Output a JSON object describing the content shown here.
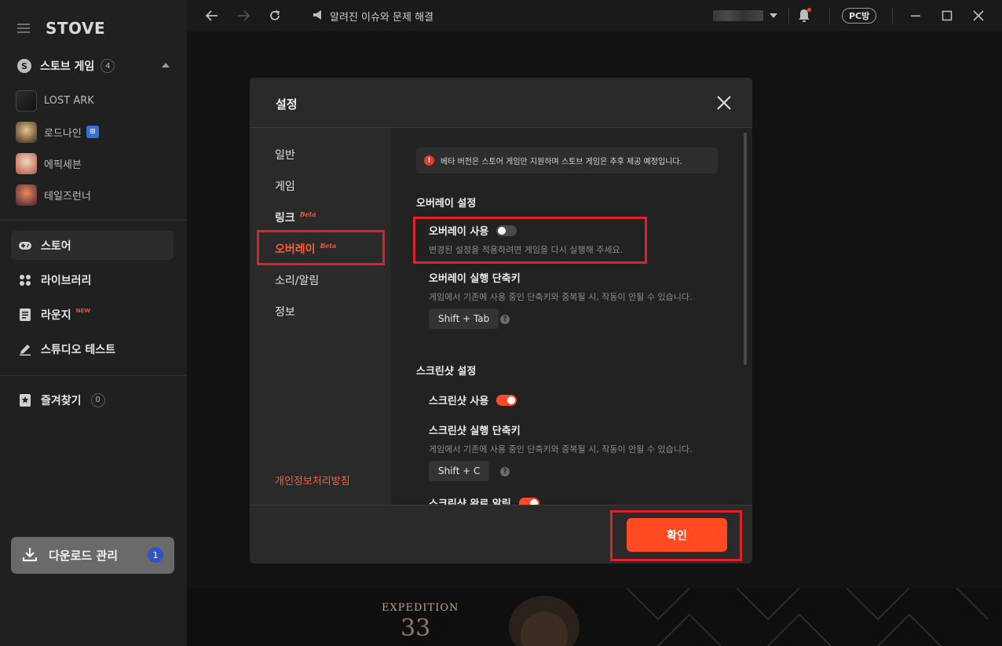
{
  "sidebar": {
    "logo": "STOVE",
    "section_title": "스토브 게임",
    "section_count": "4",
    "games": [
      {
        "label": "LOST ARK",
        "badge": ""
      },
      {
        "label": "로드나인",
        "badge": "⊞"
      },
      {
        "label": "에픽세븐",
        "badge": ""
      },
      {
        "label": "테일즈런너",
        "badge": ""
      }
    ],
    "nav": [
      {
        "label": "스토어",
        "tag": ""
      },
      {
        "label": "라이브러리",
        "tag": ""
      },
      {
        "label": "라운지",
        "tag": "NEW"
      },
      {
        "label": "스튜디오 테스트",
        "tag": ""
      }
    ],
    "favorites_label": "즐겨찾기",
    "favorites_count": "0",
    "download_label": "다운로드 관리",
    "download_count": "1"
  },
  "topbar": {
    "announce": "알려진 이슈와  문제 해결",
    "pc_badge": "PC방"
  },
  "background": {
    "title": "EXPEDITION",
    "number": "33"
  },
  "dialog": {
    "title": "설정",
    "menu": [
      {
        "label": "일반",
        "beta": ""
      },
      {
        "label": "게임",
        "beta": ""
      },
      {
        "label": "링크",
        "beta": "Beta"
      },
      {
        "label": "오버레이",
        "beta": "Beta"
      },
      {
        "label": "소리/알림",
        "beta": ""
      },
      {
        "label": "정보",
        "beta": ""
      }
    ],
    "privacy": "개인정보처리방침",
    "notice": "베타 버전은 스토어 게임만 지원하며 스토브 게임은 추후 제공 예정입니다.",
    "overlay": {
      "heading": "오버레이 설정",
      "use_label": "오버레이 사용",
      "use_desc": "변경된 설정을 적용하려면 게임을 다시 실행해 주세요.",
      "use_on": false,
      "shortcut_label": "오버레이 실행 단축키",
      "shortcut_desc": "게임에서 기존에 사용 중인 단축키와 중복될 시, 작동이 안될 수 있습니다.",
      "shortcut_value": "Shift + Tab"
    },
    "screenshot": {
      "heading": "스크린샷 설정",
      "use_label": "스크린샷 사용",
      "use_on": true,
      "shortcut_label": "스크린샷 실행 단축키",
      "shortcut_desc": "게임에서 기존에 사용 중인 단축키와 중복될 시, 작동이 안될 수 있습니다.",
      "shortcut_value": "Shift + C",
      "complete_label": "스크린샷 완료 알림",
      "complete_on": true
    },
    "confirm": "확인"
  },
  "colors": {
    "accent": "#ff4a22",
    "highlight": "#e0202a"
  }
}
